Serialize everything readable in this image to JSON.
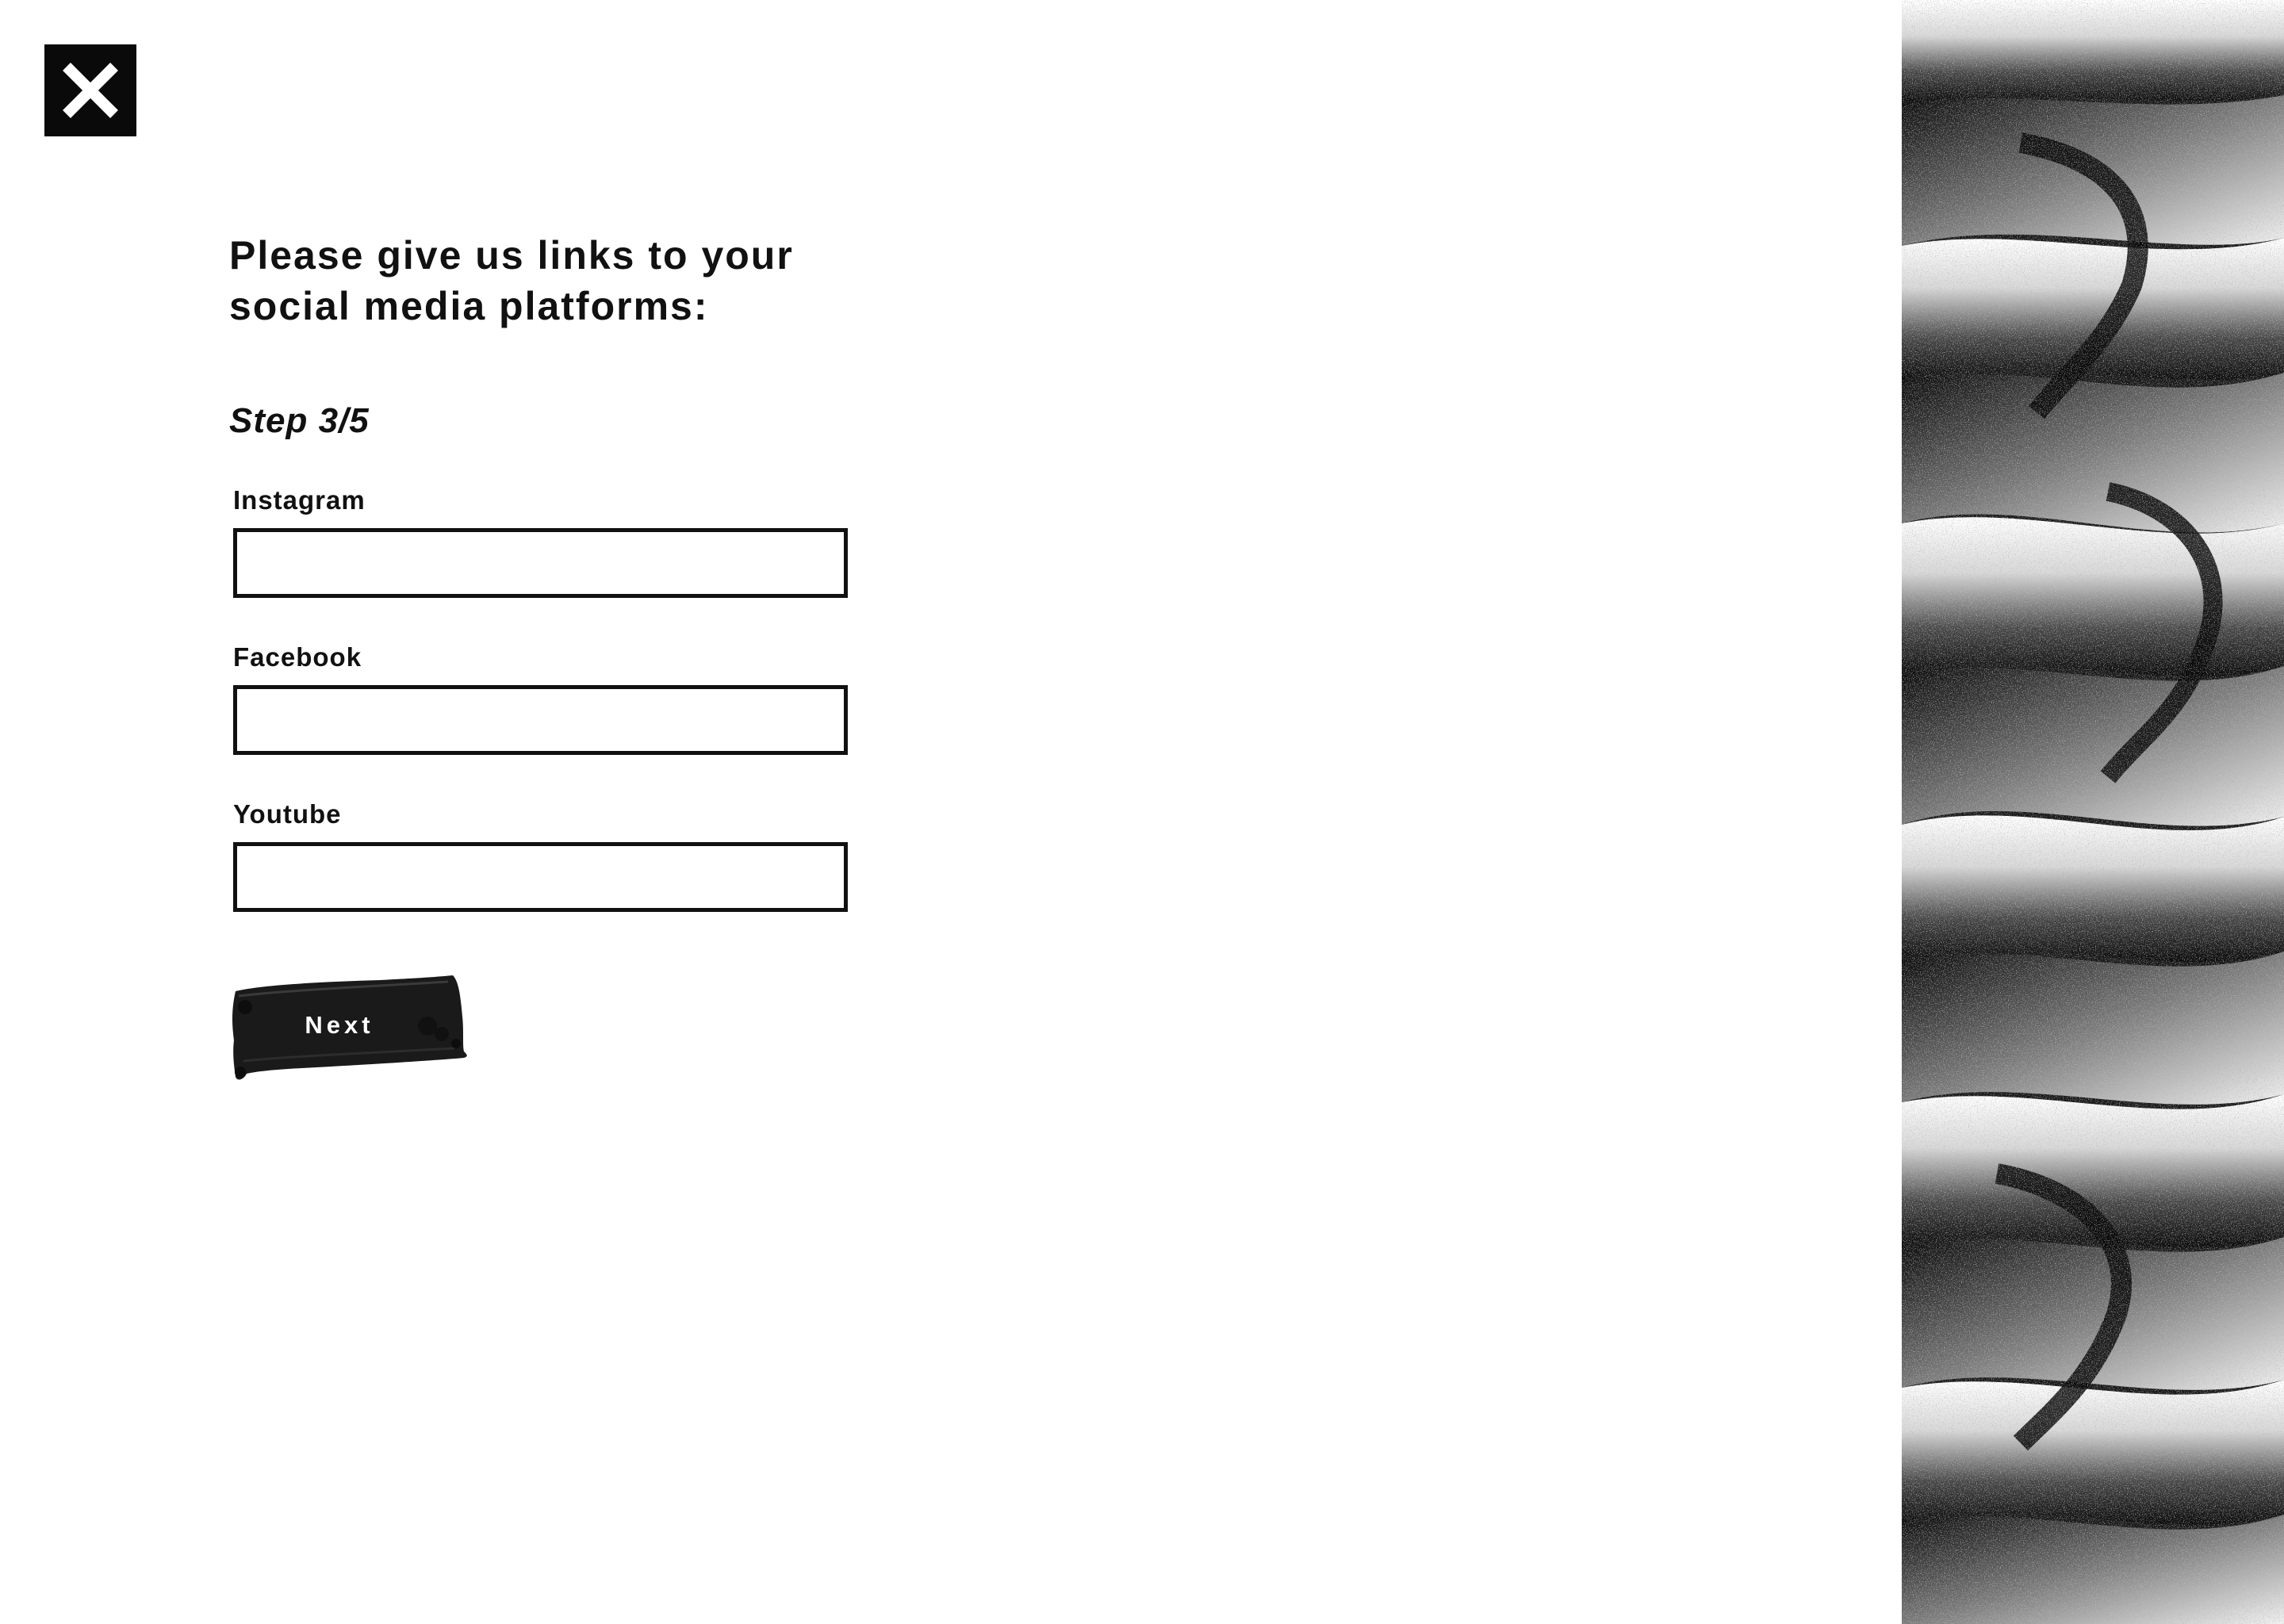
{
  "close": {
    "icon": "close-icon",
    "label": "Close"
  },
  "form": {
    "title": "Please give us links to your social media platforms:",
    "step": "Step 3/5",
    "fields": [
      {
        "label": "Instagram",
        "value": "",
        "placeholder": ""
      },
      {
        "label": "Facebook",
        "value": "",
        "placeholder": ""
      },
      {
        "label": "Youtube",
        "value": "",
        "placeholder": ""
      }
    ],
    "next_label": "Next"
  },
  "colors": {
    "background": "#ffffff",
    "text": "#111111",
    "close_bg": "#0a0a0a",
    "button_ink": "#1a1a1a"
  }
}
